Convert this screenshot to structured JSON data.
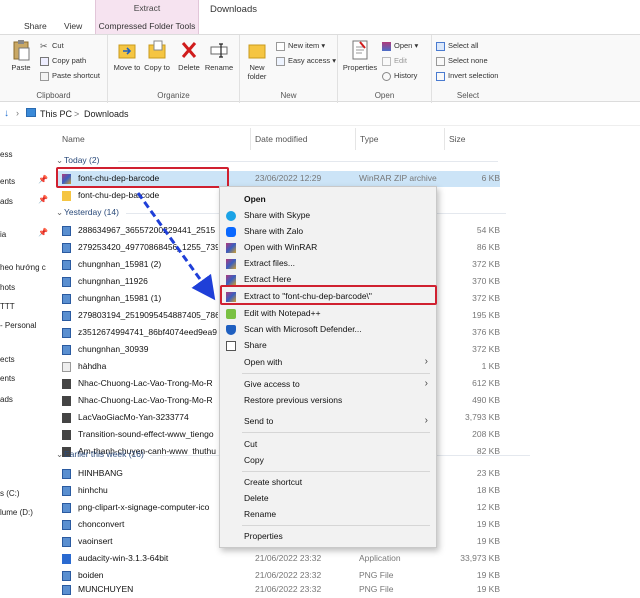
{
  "ribbon_tabs": {
    "share": "Share",
    "view": "View",
    "extract": "Extract",
    "compressed": "Compressed Folder Tools",
    "title": "Downloads"
  },
  "ribbon": {
    "clipboard": {
      "label": "Clipboard",
      "paste": "Paste",
      "cut": "Cut",
      "copy_path": "Copy path",
      "paste_shortcut": "Paste shortcut"
    },
    "organize": {
      "label": "Organize",
      "move_to": "Move to",
      "copy_to": "Copy to",
      "delete": "Delete",
      "rename": "Rename"
    },
    "new": {
      "label": "New",
      "new_folder": "New folder",
      "new_item": "New item",
      "easy_access": "Easy access"
    },
    "open": {
      "label": "Open",
      "properties": "Properties",
      "open": "Open",
      "edit": "Edit",
      "history": "History"
    },
    "select": {
      "label": "Select",
      "select_all": "Select all",
      "select_none": "Select none",
      "invert": "Invert selection"
    }
  },
  "address": {
    "this_pc": "This PC",
    "sep": ">",
    "folder": "Downloads"
  },
  "columns": {
    "name": "Name",
    "date": "Date modified",
    "type": "Type",
    "size": "Size"
  },
  "nav": [
    "ess",
    "ents",
    "ads",
    "ia",
    "heo hướng c",
    "hots",
    "TTT",
    "- Personal",
    "ects",
    "ents",
    "ads",
    "s (C:)",
    "lume (D:)"
  ],
  "groups": {
    "today": "Today (2)",
    "yesterday": "Yesterday (14)",
    "earlier": "Earlier this week (16)"
  },
  "files_today": [
    {
      "name": "font-chu-dep-barcode",
      "date": "23/06/2022 12:29",
      "type": "WinRAR ZIP archive",
      "size": "6 KB"
    },
    {
      "name": "font-chu-dep-barcode",
      "date": "",
      "type": "",
      "size": ""
    }
  ],
  "files_yesterday": [
    {
      "name": "288634967_36557200229441_2515",
      "size": "54 KB"
    },
    {
      "name": "279253420_49770868456_1255_739",
      "size": "86 KB"
    },
    {
      "name": "chungnhan_15981 (2)",
      "size": "372 KB"
    },
    {
      "name": "chungnhan_11926",
      "size": "370 KB"
    },
    {
      "name": "chungnhan_15981 (1)",
      "size": "372 KB"
    },
    {
      "name": "279803194_2519095454887405_786",
      "size": "195 KB"
    },
    {
      "name": "z3512674994741_86bf4074eed9ea9",
      "size": "376 KB"
    },
    {
      "name": "chungnhan_30939",
      "size": "372 KB"
    },
    {
      "name": "hàhdha",
      "size": "1 KB"
    },
    {
      "name": "Nhac-Chuong-Lac-Vao-Trong-Mo-R",
      "size": "612 KB"
    },
    {
      "name": "Nhac-Chuong-Lac-Vao-Trong-Mo-R",
      "size": "490 KB"
    },
    {
      "name": "LacVaoGiacMo-Yan-3233774",
      "size": "3,793 KB"
    },
    {
      "name": "Transition-sound-effect-www_tiengo",
      "size": "208 KB"
    },
    {
      "name": "Am-thanh-chuyen-canh-www_thuthu",
      "size": "82 KB"
    }
  ],
  "files_earlier": [
    {
      "name": "HINHBANG",
      "date": "",
      "type": "",
      "size": "23 KB"
    },
    {
      "name": "hinhchu",
      "date": "",
      "type": "",
      "size": "18 KB"
    },
    {
      "name": "png-clipart-x-signage-computer-ico",
      "date": "",
      "type": "",
      "size": "12 KB"
    },
    {
      "name": "chonconvert",
      "date": "",
      "type": "",
      "size": "19 KB"
    },
    {
      "name": "vaoinsert",
      "date": "",
      "type": "",
      "size": "19 KB"
    },
    {
      "name": "audacity-win-3.1.3-64bit",
      "date": "21/06/2022 23:32",
      "type": "Application",
      "size": "33,973 KB"
    },
    {
      "name": "boiden",
      "date": "21/06/2022 23:32",
      "type": "PNG File",
      "size": "19 KB"
    },
    {
      "name": "MUNCHUYEN",
      "date": "21/06/2022 23:32",
      "type": "PNG File",
      "size": "19 KB"
    }
  ],
  "context_menu": [
    {
      "label": "Open",
      "bold": true,
      "icon": "none"
    },
    {
      "label": "Share with Skype",
      "icon": "skype-icon"
    },
    {
      "label": "Share with Zalo",
      "icon": "zalo-icon"
    },
    {
      "label": "Open with WinRAR",
      "icon": "winrar-icon"
    },
    {
      "label": "Extract files...",
      "icon": "winrar-icon"
    },
    {
      "label": "Extract Here",
      "icon": "winrar-icon"
    },
    {
      "label": "Extract to \"font-chu-dep-barcode\\\"",
      "icon": "winrar-icon",
      "highlight": true
    },
    {
      "label": "Edit with Notepad++",
      "icon": "notepad-icon"
    },
    {
      "label": "Scan with Microsoft Defender...",
      "icon": "defender-icon"
    },
    {
      "label": "Share",
      "icon": "share-icon"
    },
    {
      "label": "Open with",
      "icon": "none",
      "submenu": true
    },
    {
      "label": "Give access to",
      "icon": "none",
      "submenu": true
    },
    {
      "label": "Restore previous versions",
      "icon": "none"
    },
    {
      "label": "Send to",
      "icon": "none",
      "submenu": true
    },
    {
      "label": "Cut",
      "icon": "none"
    },
    {
      "label": "Copy",
      "icon": "none"
    },
    {
      "label": "Create shortcut",
      "icon": "none"
    },
    {
      "label": "Delete",
      "icon": "none"
    },
    {
      "label": "Rename",
      "icon": "none"
    },
    {
      "label": "Properties",
      "icon": "none"
    }
  ],
  "colors": {
    "highlight_red": "#d02030",
    "arrow_blue": "#1f3fd8",
    "selection": "#cce4f7",
    "ctx_tab": "#f6e3f0"
  }
}
